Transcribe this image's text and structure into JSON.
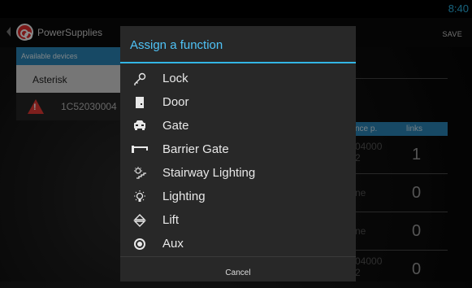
{
  "status_bar": {
    "time": "8:40"
  },
  "action_bar": {
    "title": "PowerSupplies",
    "save_label": "SAVE"
  },
  "left_panel": {
    "header": "Available devices",
    "items": [
      {
        "label": "Asterisk"
      },
      {
        "label": "1C52030004"
      }
    ]
  },
  "right_panel": {
    "columns": [
      "nce p.",
      "links"
    ],
    "rows": [
      {
        "code_top": "04000",
        "code_bottom": "2",
        "links": "1"
      },
      {
        "code_top": "ne",
        "code_bottom": "",
        "links": "0"
      },
      {
        "code_top": "ne",
        "code_bottom": "",
        "links": "0"
      },
      {
        "code_top": "04000",
        "code_bottom": "2",
        "links": "0"
      }
    ]
  },
  "dialog": {
    "title": "Assign a function",
    "items": [
      {
        "label": "Lock",
        "icon": "key-icon"
      },
      {
        "label": "Door",
        "icon": "door-icon"
      },
      {
        "label": "Gate",
        "icon": "gate-icon"
      },
      {
        "label": "Barrier Gate",
        "icon": "barrier-gate-icon"
      },
      {
        "label": "Stairway Lighting",
        "icon": "stairway-lighting-icon"
      },
      {
        "label": "Lighting",
        "icon": "lighting-icon"
      },
      {
        "label": "Lift",
        "icon": "lift-icon"
      },
      {
        "label": "Aux",
        "icon": "aux-icon"
      }
    ],
    "cancel_label": "Cancel"
  },
  "colors": {
    "accent": "#33b5e5",
    "header_blue": "#2a86b8",
    "alert_red": "#e53935"
  }
}
